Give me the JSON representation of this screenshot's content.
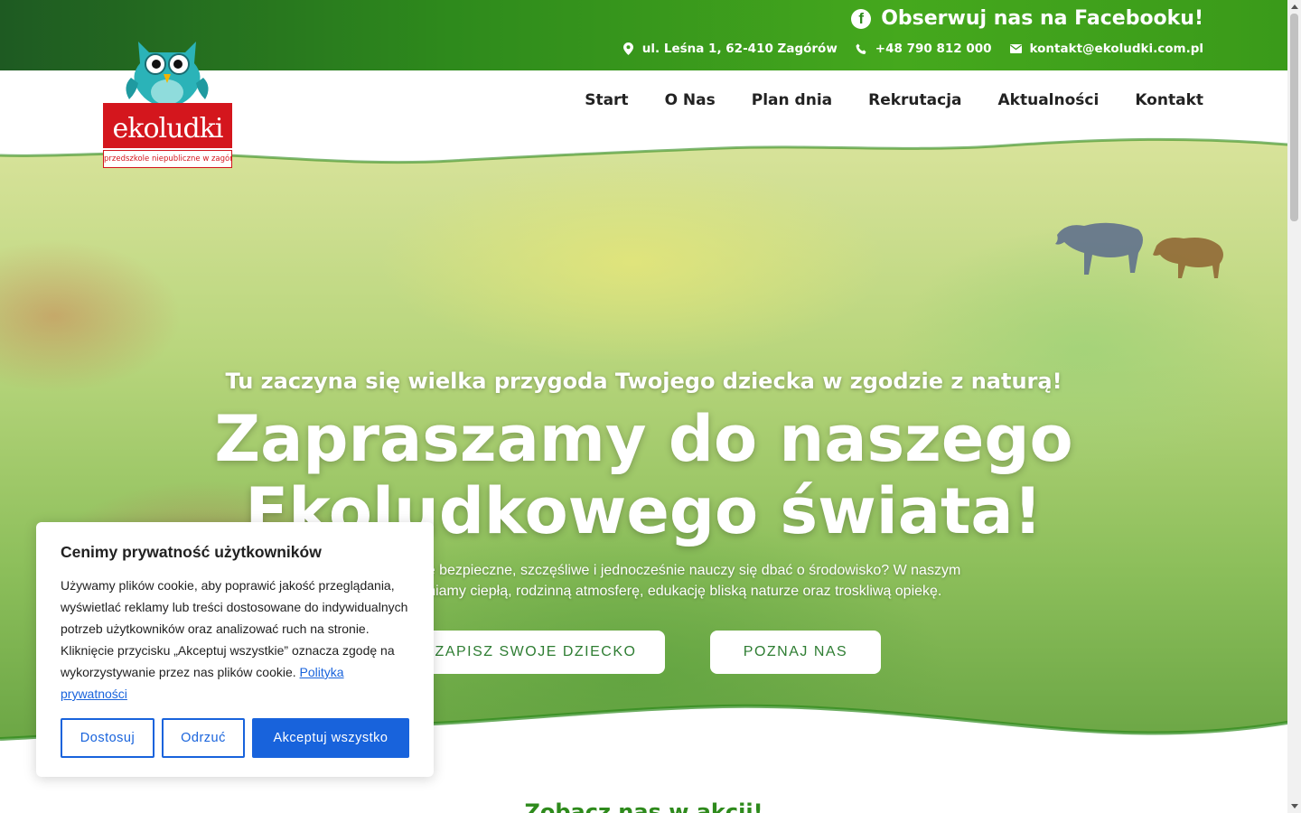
{
  "topbar": {
    "facebook_label": "Obserwuj nas na Facebooku!",
    "address": "ul. Leśna 1, 62-410 Zagórów",
    "phone": "+48 790 812 000",
    "email": "kontakt@ekoludki.com.pl"
  },
  "logo": {
    "name": "ekoludki",
    "subtitle": "przedszkole niepubliczne w zagórowie"
  },
  "nav": {
    "items": [
      "Start",
      "O Nas",
      "Plan dnia",
      "Rekrutacja",
      "Aktualności",
      "Kontakt"
    ]
  },
  "hero": {
    "tagline": "Tu zaczyna się wielka przygoda Twojego dziecka w zgodzie z naturą!",
    "headline_line1": "Zapraszamy do naszego",
    "headline_line2": "Ekoludkowego świata!",
    "lead_line1": "…iecko będzie bezpieczne, szczęśliwe i jednocześnie nauczy się dbać o środowisko? W naszym",
    "lead_line2": "…u zapewniamy ciepłą, rodzinną atmosferę, edukację bliską naturze oraz troskliwą opiekę.",
    "btn_enroll": "ZAPISZ SWOJE DZIECKO",
    "btn_about": "POZNAJ NAS"
  },
  "next_section_title": "Zobacz nas w akcji!",
  "cookie": {
    "title": "Cenimy prywatność użytkowników",
    "text": "Używamy plików cookie, aby poprawić jakość przeglądania, wyświetlać reklamy lub treści dostosowane do indywidualnych potrzeb użytkowników oraz analizować ruch na stronie. Kliknięcie przycisku „Akceptuj wszystkie” oznacza zgodę na wykorzystywanie przez nas plików cookie.",
    "link": "Polityka prywatności",
    "btn_customize": "Dostosuj",
    "btn_reject": "Odrzuć",
    "btn_accept": "Akceptuj wszystko"
  },
  "colors": {
    "brand_green": "#2e8a1c",
    "logo_red": "#d4161d",
    "cookie_blue": "#1863dc"
  }
}
